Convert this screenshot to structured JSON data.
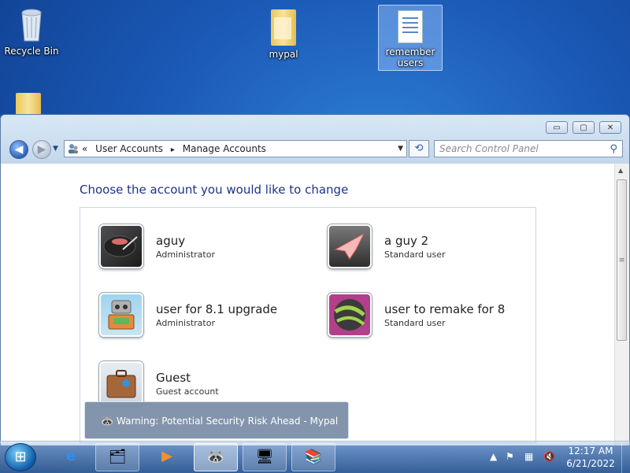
{
  "desktop": {
    "icons": [
      {
        "label": "Recycle Bin"
      },
      {
        "label": "mypal"
      },
      {
        "label": "remember users"
      }
    ]
  },
  "window": {
    "controls": {
      "minimize": "▭",
      "maximize": "▢",
      "close": "✕"
    },
    "address": {
      "recent_glyph": "«",
      "crumbs": [
        "User Accounts",
        "Manage Accounts"
      ],
      "separator": "▸"
    },
    "search": {
      "placeholder": "Search Control Panel"
    },
    "heading": "Choose the account you would like to change",
    "accounts": [
      {
        "name": "aguy",
        "type": "Administrator",
        "avatar": "turntable-icon"
      },
      {
        "name": "a guy 2",
        "type": "Standard user",
        "avatar": "origami-crane-icon"
      },
      {
        "name": "user for 8.1 upgrade",
        "type": "Administrator",
        "avatar": "robot-icon"
      },
      {
        "name": "user to remake for 8",
        "type": "Standard user",
        "avatar": "ball-icon"
      },
      {
        "name": "Guest",
        "type": "Guest account",
        "avatar": "suitcase-icon"
      }
    ]
  },
  "taskbar_preview": {
    "text": "Warning: Potential Security Risk Ahead - Mypal"
  },
  "taskbar": {
    "clock": {
      "time": "12:17 AM",
      "date": "6/21/2022"
    }
  }
}
